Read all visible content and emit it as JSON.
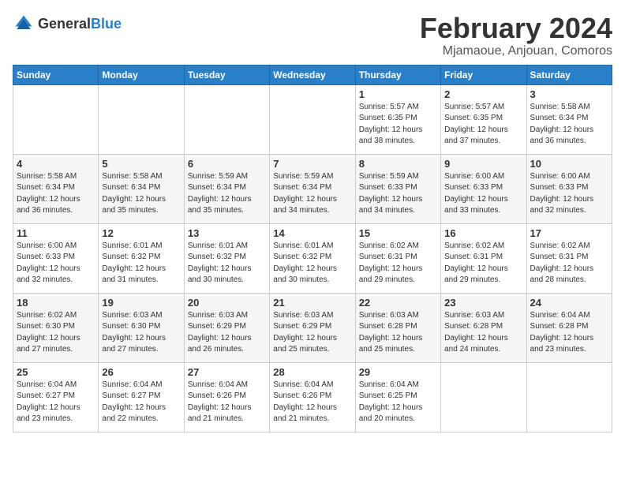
{
  "header": {
    "logo_general": "General",
    "logo_blue": "Blue",
    "month": "February 2024",
    "location": "Mjamaoue, Anjouan, Comoros"
  },
  "days_of_week": [
    "Sunday",
    "Monday",
    "Tuesday",
    "Wednesday",
    "Thursday",
    "Friday",
    "Saturday"
  ],
  "weeks": [
    [
      {
        "day": "",
        "info": ""
      },
      {
        "day": "",
        "info": ""
      },
      {
        "day": "",
        "info": ""
      },
      {
        "day": "",
        "info": ""
      },
      {
        "day": "1",
        "info": "Sunrise: 5:57 AM\nSunset: 6:35 PM\nDaylight: 12 hours\nand 38 minutes."
      },
      {
        "day": "2",
        "info": "Sunrise: 5:57 AM\nSunset: 6:35 PM\nDaylight: 12 hours\nand 37 minutes."
      },
      {
        "day": "3",
        "info": "Sunrise: 5:58 AM\nSunset: 6:34 PM\nDaylight: 12 hours\nand 36 minutes."
      }
    ],
    [
      {
        "day": "4",
        "info": "Sunrise: 5:58 AM\nSunset: 6:34 PM\nDaylight: 12 hours\nand 36 minutes."
      },
      {
        "day": "5",
        "info": "Sunrise: 5:58 AM\nSunset: 6:34 PM\nDaylight: 12 hours\nand 35 minutes."
      },
      {
        "day": "6",
        "info": "Sunrise: 5:59 AM\nSunset: 6:34 PM\nDaylight: 12 hours\nand 35 minutes."
      },
      {
        "day": "7",
        "info": "Sunrise: 5:59 AM\nSunset: 6:34 PM\nDaylight: 12 hours\nand 34 minutes."
      },
      {
        "day": "8",
        "info": "Sunrise: 5:59 AM\nSunset: 6:33 PM\nDaylight: 12 hours\nand 34 minutes."
      },
      {
        "day": "9",
        "info": "Sunrise: 6:00 AM\nSunset: 6:33 PM\nDaylight: 12 hours\nand 33 minutes."
      },
      {
        "day": "10",
        "info": "Sunrise: 6:00 AM\nSunset: 6:33 PM\nDaylight: 12 hours\nand 32 minutes."
      }
    ],
    [
      {
        "day": "11",
        "info": "Sunrise: 6:00 AM\nSunset: 6:33 PM\nDaylight: 12 hours\nand 32 minutes."
      },
      {
        "day": "12",
        "info": "Sunrise: 6:01 AM\nSunset: 6:32 PM\nDaylight: 12 hours\nand 31 minutes."
      },
      {
        "day": "13",
        "info": "Sunrise: 6:01 AM\nSunset: 6:32 PM\nDaylight: 12 hours\nand 30 minutes."
      },
      {
        "day": "14",
        "info": "Sunrise: 6:01 AM\nSunset: 6:32 PM\nDaylight: 12 hours\nand 30 minutes."
      },
      {
        "day": "15",
        "info": "Sunrise: 6:02 AM\nSunset: 6:31 PM\nDaylight: 12 hours\nand 29 minutes."
      },
      {
        "day": "16",
        "info": "Sunrise: 6:02 AM\nSunset: 6:31 PM\nDaylight: 12 hours\nand 29 minutes."
      },
      {
        "day": "17",
        "info": "Sunrise: 6:02 AM\nSunset: 6:31 PM\nDaylight: 12 hours\nand 28 minutes."
      }
    ],
    [
      {
        "day": "18",
        "info": "Sunrise: 6:02 AM\nSunset: 6:30 PM\nDaylight: 12 hours\nand 27 minutes."
      },
      {
        "day": "19",
        "info": "Sunrise: 6:03 AM\nSunset: 6:30 PM\nDaylight: 12 hours\nand 27 minutes."
      },
      {
        "day": "20",
        "info": "Sunrise: 6:03 AM\nSunset: 6:29 PM\nDaylight: 12 hours\nand 26 minutes."
      },
      {
        "day": "21",
        "info": "Sunrise: 6:03 AM\nSunset: 6:29 PM\nDaylight: 12 hours\nand 25 minutes."
      },
      {
        "day": "22",
        "info": "Sunrise: 6:03 AM\nSunset: 6:28 PM\nDaylight: 12 hours\nand 25 minutes."
      },
      {
        "day": "23",
        "info": "Sunrise: 6:03 AM\nSunset: 6:28 PM\nDaylight: 12 hours\nand 24 minutes."
      },
      {
        "day": "24",
        "info": "Sunrise: 6:04 AM\nSunset: 6:28 PM\nDaylight: 12 hours\nand 23 minutes."
      }
    ],
    [
      {
        "day": "25",
        "info": "Sunrise: 6:04 AM\nSunset: 6:27 PM\nDaylight: 12 hours\nand 23 minutes."
      },
      {
        "day": "26",
        "info": "Sunrise: 6:04 AM\nSunset: 6:27 PM\nDaylight: 12 hours\nand 22 minutes."
      },
      {
        "day": "27",
        "info": "Sunrise: 6:04 AM\nSunset: 6:26 PM\nDaylight: 12 hours\nand 21 minutes."
      },
      {
        "day": "28",
        "info": "Sunrise: 6:04 AM\nSunset: 6:26 PM\nDaylight: 12 hours\nand 21 minutes."
      },
      {
        "day": "29",
        "info": "Sunrise: 6:04 AM\nSunset: 6:25 PM\nDaylight: 12 hours\nand 20 minutes."
      },
      {
        "day": "",
        "info": ""
      },
      {
        "day": "",
        "info": ""
      }
    ]
  ]
}
